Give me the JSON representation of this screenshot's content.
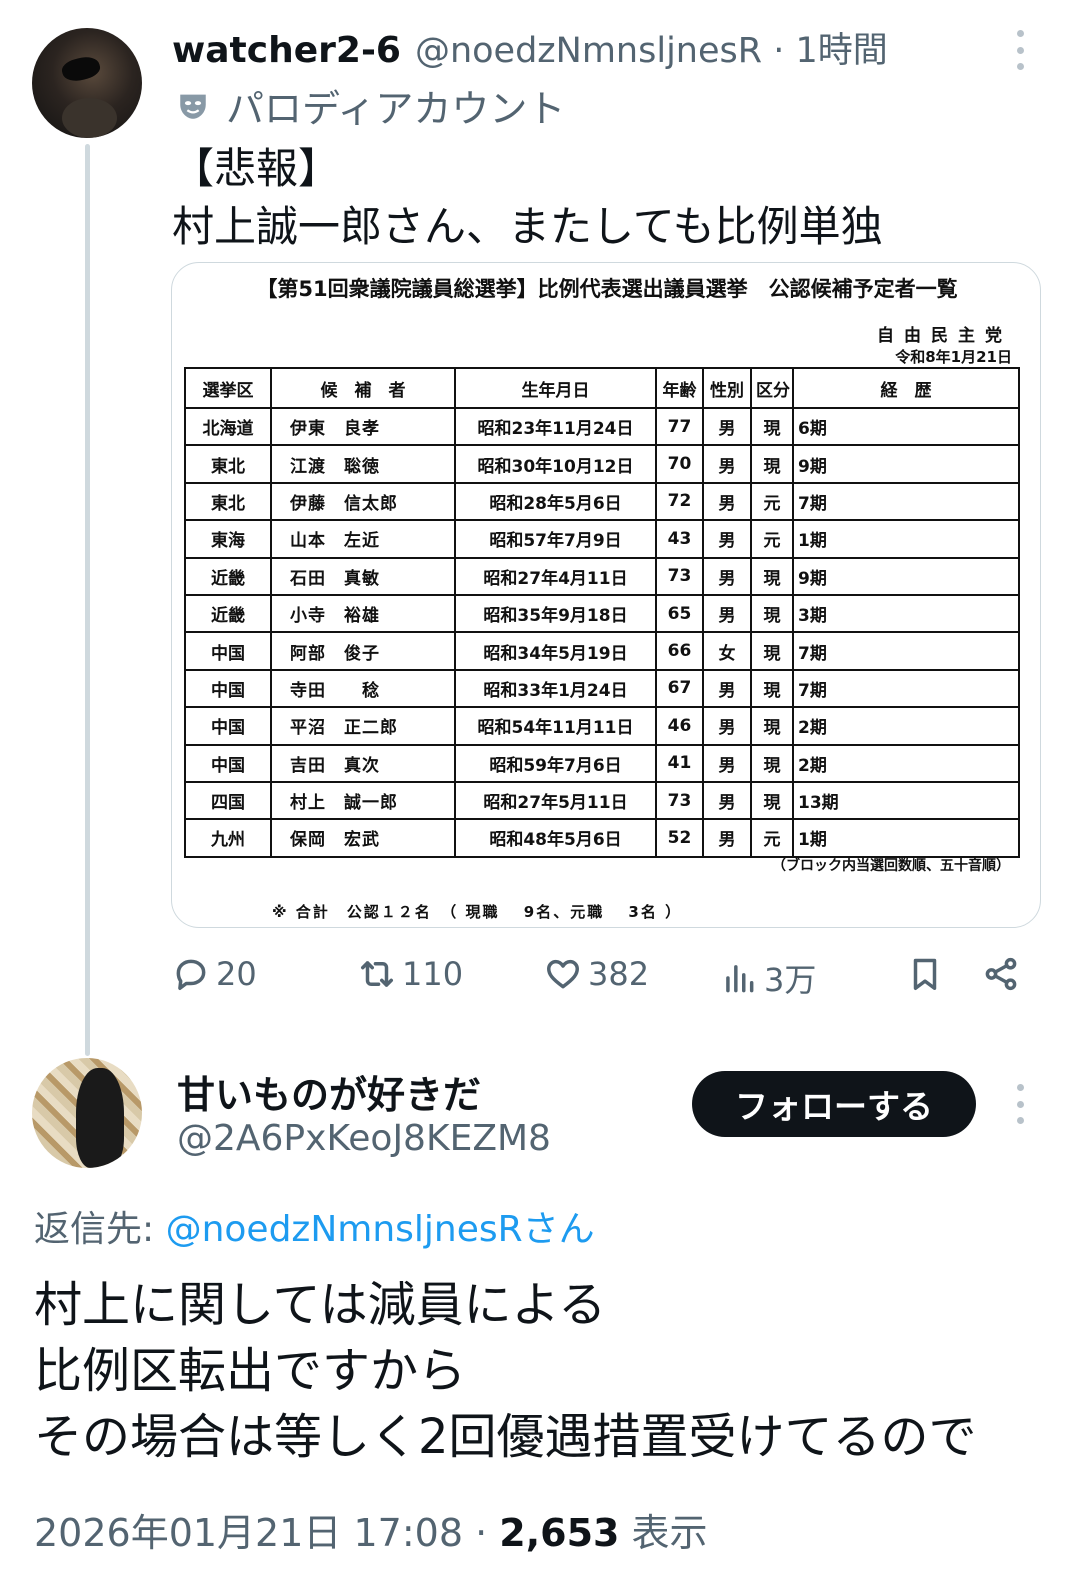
{
  "original_tweet": {
    "display_name": "watcher2-6",
    "handle": "@noedzNmnsljnesR",
    "separator": "·",
    "time_ago": "1時間",
    "label": "パロディアカウント",
    "text_lines": [
      "【悲報】",
      "村上誠一郎さん、またしても比例単独"
    ],
    "image": {
      "title": "【第51回衆議院議員総選挙】比例代表選出議員選挙　公認候補予定者一覧",
      "party": "自由民主党",
      "date": "令和8年1月21日",
      "headers": [
        "選挙区",
        "候　補　者",
        "生年月日",
        "年齢",
        "性別",
        "区分",
        "経　歴"
      ],
      "rows": [
        [
          "北海道",
          "伊東　良孝",
          "昭和23年11月24日",
          "77",
          "男",
          "現",
          "6期"
        ],
        [
          "東北",
          "江渡　聡徳",
          "昭和30年10月12日",
          "70",
          "男",
          "現",
          "9期"
        ],
        [
          "東北",
          "伊藤　信太郎",
          "昭和28年5月6日",
          "72",
          "男",
          "元",
          "7期"
        ],
        [
          "東海",
          "山本　左近",
          "昭和57年7月9日",
          "43",
          "男",
          "元",
          "1期"
        ],
        [
          "近畿",
          "石田　真敏",
          "昭和27年4月11日",
          "73",
          "男",
          "現",
          "9期"
        ],
        [
          "近畿",
          "小寺　裕雄",
          "昭和35年9月18日",
          "65",
          "男",
          "現",
          "3期"
        ],
        [
          "中国",
          "阿部　俊子",
          "昭和34年5月19日",
          "66",
          "女",
          "現",
          "7期"
        ],
        [
          "中国",
          "寺田　　稔",
          "昭和33年1月24日",
          "67",
          "男",
          "現",
          "7期"
        ],
        [
          "中国",
          "平沼　正二郎",
          "昭和54年11月11日",
          "46",
          "男",
          "現",
          "2期"
        ],
        [
          "中国",
          "吉田　真次",
          "昭和59年7月6日",
          "41",
          "男",
          "現",
          "2期"
        ],
        [
          "四国",
          "村上　誠一郎",
          "昭和27年5月11日",
          "73",
          "男",
          "現",
          "13期"
        ],
        [
          "九州",
          "保岡　宏武",
          "昭和48年5月6日",
          "52",
          "男",
          "元",
          "1期"
        ]
      ],
      "note": "（ブロック内当選回数順、五十音順）",
      "total": "※ 合計　公認１２名　（ 現職　 9名、元職　 3名 ）"
    },
    "stats": {
      "replies": "20",
      "retweets": "110",
      "likes": "382",
      "views": "3万"
    }
  },
  "reply_tweet": {
    "display_name": "甘いものが好きだ",
    "handle": "@2A6PxKeoJ8KEZM8",
    "follow_label": "フォローする",
    "reply_to_label": "返信先: ",
    "reply_to_mention": "@noedzNmnsljnesRさん",
    "text_lines": [
      "村上に関しては減員による",
      "比例区転出ですから",
      "その場合は等しく2回優遇措置受けてるので"
    ],
    "timestamp": "2026年01月21日 17:08",
    "separator": " · ",
    "views_count": "2,653",
    "views_label": " 表示"
  },
  "icons": {
    "reply": "reply-icon",
    "retweet": "retweet-icon",
    "like": "like-icon",
    "views": "views-icon",
    "bookmark": "bookmark-icon",
    "share": "share-icon",
    "more": "more-icon",
    "parody": "mask-icon"
  },
  "colors": {
    "text": "#0f1419",
    "secondary": "#536471",
    "link": "#1d9bf0",
    "button_bg": "#0f1419",
    "thread_line": "#cfd9de"
  }
}
